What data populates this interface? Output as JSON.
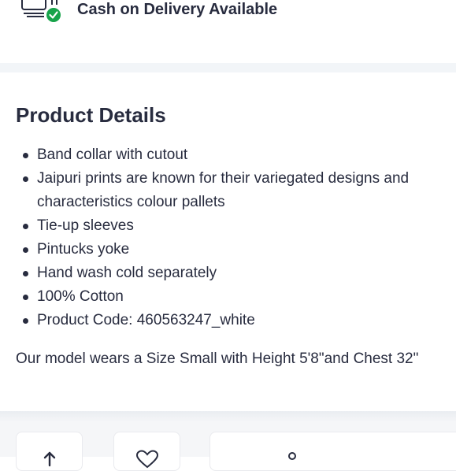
{
  "delivery": {
    "cod_label": "Cash on Delivery Available",
    "icon": "cash-check-icon",
    "check_color": "#17a34a"
  },
  "product_details": {
    "title": "Product Details",
    "items": [
      "Band collar with cutout",
      "Jaipuri prints are known for their variegated designs and characteristics colour pallets",
      "Tie-up sleeves",
      "Pintucks yoke",
      "Hand wash cold separately",
      "100% Cotton",
      "Product Code: 460563247_white"
    ],
    "model_note": "Our model wears a Size Small with Height 5'8\"and Chest 32\""
  },
  "action_bar": {
    "share_icon": "share-icon",
    "wishlist_icon": "heart-icon",
    "bag_icon": "bag-icon"
  },
  "colors": {
    "text": "#282c3f",
    "divider": "#f2f5f8"
  }
}
